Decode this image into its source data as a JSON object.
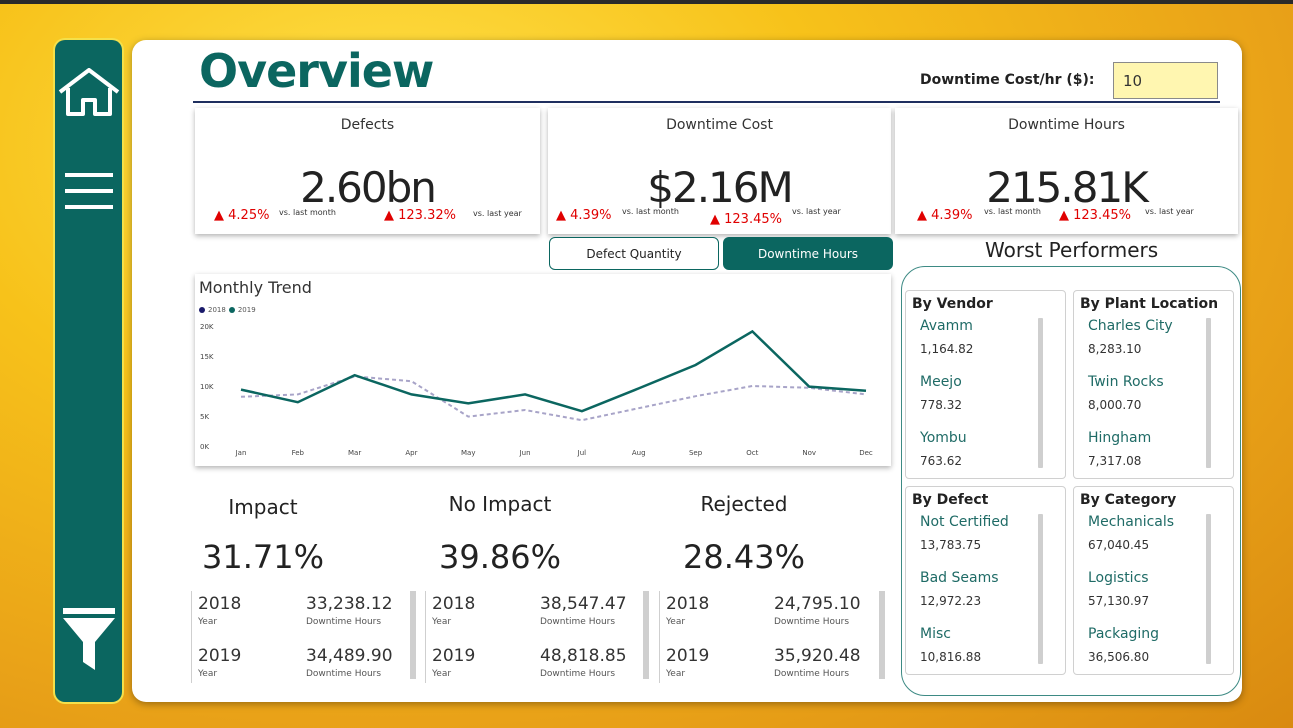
{
  "header": {
    "title": "Overview",
    "cost_label": "Downtime Cost/hr ($):",
    "cost_value": "10"
  },
  "kpis": [
    {
      "title": "Defects",
      "value": "2.60bn",
      "month_change": "4.25%",
      "year_change": "123.32%"
    },
    {
      "title": "Downtime Cost",
      "value": "$2.16M",
      "month_change": "4.39%",
      "year_change": "123.45%"
    },
    {
      "title": "Downtime Hours",
      "value": "215.81K",
      "month_change": "4.39%",
      "year_change": "123.45%"
    }
  ],
  "vs_month": "vs. last month",
  "vs_year": "vs. last year",
  "toggles": {
    "defect_quantity": "Defect Quantity",
    "downtime_hours": "Downtime Hours"
  },
  "chart_data": {
    "type": "line",
    "title": "Monthly Trend",
    "categories": [
      "Jan",
      "Feb",
      "Mar",
      "Apr",
      "May",
      "Jun",
      "Jul",
      "Aug",
      "Sep",
      "Oct",
      "Nov",
      "Dec"
    ],
    "series": [
      {
        "name": "2018",
        "values": [
          8200,
          8600,
          11600,
          10800,
          4900,
          6000,
          4300,
          6300,
          8300,
          10000,
          9700,
          8600
        ]
      },
      {
        "name": "2019",
        "values": [
          9400,
          7300,
          11800,
          8600,
          7100,
          8600,
          5800,
          9600,
          13500,
          19100,
          9900,
          9200
        ]
      }
    ],
    "ylim": [
      0,
      20000
    ],
    "yticks": [
      "0K",
      "5K",
      "10K",
      "15K",
      "20K"
    ],
    "colors": {
      "2018": "#a8a4c8",
      "2019": "#0b6660"
    }
  },
  "sections": [
    {
      "title": "Impact",
      "pct": "31.71%",
      "rows": [
        {
          "year": "2018",
          "val": "33,238.12"
        },
        {
          "year": "2019",
          "val": "34,489.90"
        }
      ]
    },
    {
      "title": "No Impact",
      "pct": "39.86%",
      "rows": [
        {
          "year": "2018",
          "val": "38,547.47"
        },
        {
          "year": "2019",
          "val": "48,818.85"
        }
      ]
    },
    {
      "title": "Rejected",
      "pct": "28.43%",
      "rows": [
        {
          "year": "2018",
          "val": "24,795.10"
        },
        {
          "year": "2019",
          "val": "35,920.48"
        }
      ]
    }
  ],
  "labels": {
    "year": "Year",
    "downtime_hours": "Downtime Hours"
  },
  "worst": {
    "title": "Worst Performers",
    "groups": [
      {
        "title": "By Vendor",
        "items": [
          {
            "name": "Avamm",
            "value": "1,164.82"
          },
          {
            "name": "Meejo",
            "value": "778.32"
          },
          {
            "name": "Yombu",
            "value": "763.62"
          }
        ]
      },
      {
        "title": "By Plant Location",
        "items": [
          {
            "name": "Charles City",
            "value": "8,283.10"
          },
          {
            "name": "Twin Rocks",
            "value": "8,000.70"
          },
          {
            "name": "Hingham",
            "value": "7,317.08"
          }
        ]
      },
      {
        "title": "By Defect",
        "items": [
          {
            "name": "Not Certified",
            "value": "13,783.75"
          },
          {
            "name": "Bad Seams",
            "value": "12,972.23"
          },
          {
            "name": "Misc",
            "value": "10,816.88"
          }
        ]
      },
      {
        "title": "By Category",
        "items": [
          {
            "name": "Mechanicals",
            "value": "67,040.45"
          },
          {
            "name": "Logistics",
            "value": "57,130.97"
          },
          {
            "name": "Packaging",
            "value": "36,506.80"
          }
        ]
      }
    ]
  },
  "icons": {
    "home": "home-icon",
    "menu": "menu-icon",
    "filter": "filter-icon"
  },
  "colors": {
    "accent": "#0b6660",
    "negative": "#e00000"
  }
}
